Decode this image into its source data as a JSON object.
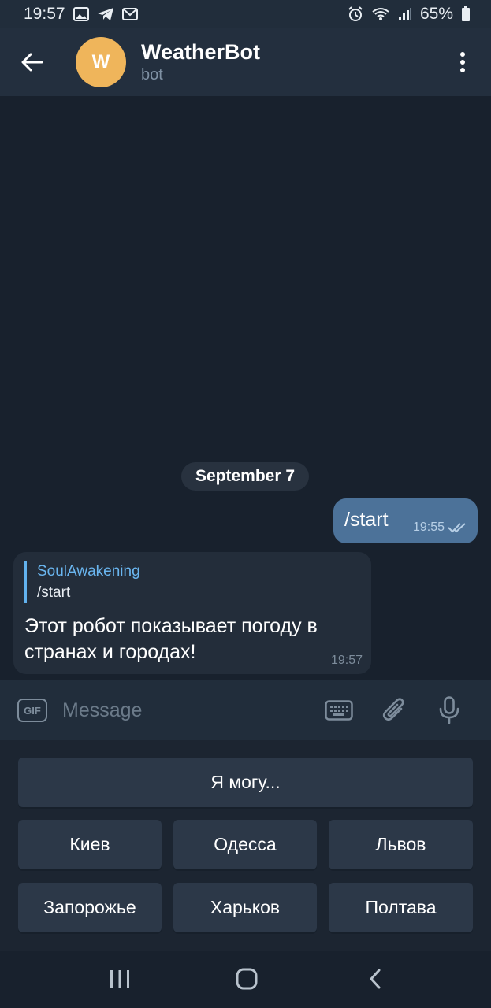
{
  "status_bar": {
    "time": "19:57",
    "battery": "65%",
    "icons_left": [
      "gallery-icon",
      "telegram-icon",
      "gmail-icon"
    ],
    "icons_right": [
      "alarm-icon",
      "wifi-icon",
      "signal-icon",
      "battery-icon"
    ]
  },
  "header": {
    "avatar_letter": "W",
    "title": "WeatherBot",
    "subtitle": "bot",
    "avatar_color": "#efb55b"
  },
  "chat": {
    "date": "September 7",
    "outgoing": {
      "text": "/start",
      "time": "19:55",
      "status": "read"
    },
    "incoming": {
      "reply_author": "SoulAwakening",
      "reply_text": "/start",
      "text": "Этот робот показывает погоду в странах и городах!",
      "time": "19:57"
    }
  },
  "input": {
    "gif_label": "GIF",
    "placeholder": "Message"
  },
  "keyboard": {
    "rows": [
      [
        "Я могу..."
      ],
      [
        "Киев",
        "Одесса",
        "Львов"
      ],
      [
        "Запорожье",
        "Харьков",
        "Полтава"
      ]
    ]
  },
  "colors": {
    "background": "#18212d",
    "header": "#232f3e",
    "outgoing_bubble": "#4c7299",
    "incoming_bubble": "#232d3a",
    "accent": "#6ab6f0"
  }
}
